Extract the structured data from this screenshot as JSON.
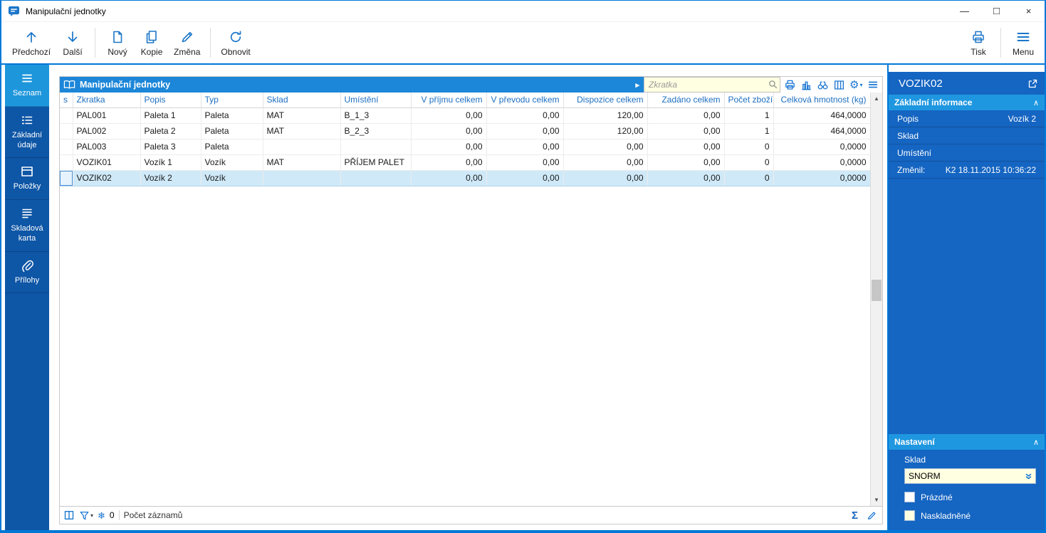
{
  "window": {
    "title": "Manipulační jednotky",
    "minimize": "—",
    "maximize": "□",
    "close": "×"
  },
  "toolbar": {
    "prev": "Předchozí",
    "next": "Další",
    "new": "Nový",
    "copy": "Kopie",
    "change": "Změna",
    "refresh": "Obnovit",
    "print": "Tisk",
    "menu": "Menu"
  },
  "sidebar": {
    "items": [
      {
        "label": "Seznam",
        "active": true
      },
      {
        "label": "Základní údaje",
        "active": false
      },
      {
        "label": "Položky",
        "active": false
      },
      {
        "label": "Skladová karta",
        "active": false
      },
      {
        "label": "Přílohy",
        "active": false
      }
    ]
  },
  "grid": {
    "title": "Manipulační jednotky",
    "search_placeholder": "Zkratka",
    "columns": [
      "s",
      "Zkratka",
      "Popis",
      "Typ",
      "Sklad",
      "Umístění",
      "V příjmu celkem",
      "V převodu celkem",
      "Dispozice celkem",
      "Zadáno celkem",
      "Počet zboží",
      "Celková hmotnost (kg)"
    ],
    "rows": [
      [
        "",
        "PAL001",
        "Paleta 1",
        "Paleta",
        "MAT",
        "B_1_3",
        "0,00",
        "0,00",
        "120,00",
        "0,00",
        "1",
        "464,0000"
      ],
      [
        "",
        "PAL002",
        "Paleta 2",
        "Paleta",
        "MAT",
        "B_2_3",
        "0,00",
        "0,00",
        "120,00",
        "0,00",
        "1",
        "464,0000"
      ],
      [
        "",
        "PAL003",
        "Paleta 3",
        "Paleta",
        "",
        "",
        "0,00",
        "0,00",
        "0,00",
        "0,00",
        "0",
        "0,0000"
      ],
      [
        "",
        "VOZIK01",
        "Vozík 1",
        "Vozík",
        "MAT",
        "PŘÍJEM PALET",
        "0,00",
        "0,00",
        "0,00",
        "0,00",
        "0",
        "0,0000"
      ],
      [
        "",
        "VOZIK02",
        "Vozík 2",
        "Vozík",
        "",
        "",
        "0,00",
        "0,00",
        "0,00",
        "0,00",
        "0",
        "0,0000"
      ]
    ],
    "selected_row_index": 4,
    "status": {
      "freeze_count": "0",
      "records_label": "Počet záznamů"
    }
  },
  "panel": {
    "title": "VOZIK02",
    "info": {
      "title": "Základní informace",
      "fields": [
        {
          "label": "Popis",
          "value": "Vozík 2"
        },
        {
          "label": "Sklad",
          "value": ""
        },
        {
          "label": "Umístění",
          "value": ""
        },
        {
          "label": "Změnil:",
          "value": "K2 18.11.2015 10:36:22"
        }
      ]
    },
    "settings": {
      "title": "Nastavení",
      "sklad_label": "Sklad",
      "sklad_value": "SNORM",
      "checkbox_empty": "Prázdné",
      "checkbox_stocked": "Naskladněné"
    }
  },
  "icons": {
    "grid_expander": "▸",
    "gear": "⚙",
    "gear_caret": "▾",
    "filter_caret": "▾",
    "snowflake": "❄",
    "sum": "Σ",
    "scroll_up": "▲",
    "scroll_down": "▼",
    "chevron_up": "∧"
  },
  "colors": {
    "accent": "#0078d7",
    "sidebar_blue": "#0e56a6",
    "active_blue": "#1e96dc",
    "panel_blue": "#1565c2",
    "section_blue": "#1f97e0",
    "grid_header_blue": "#1c86d8",
    "selection": "#cfe9f8",
    "field_yellow": "#ffffe1"
  }
}
